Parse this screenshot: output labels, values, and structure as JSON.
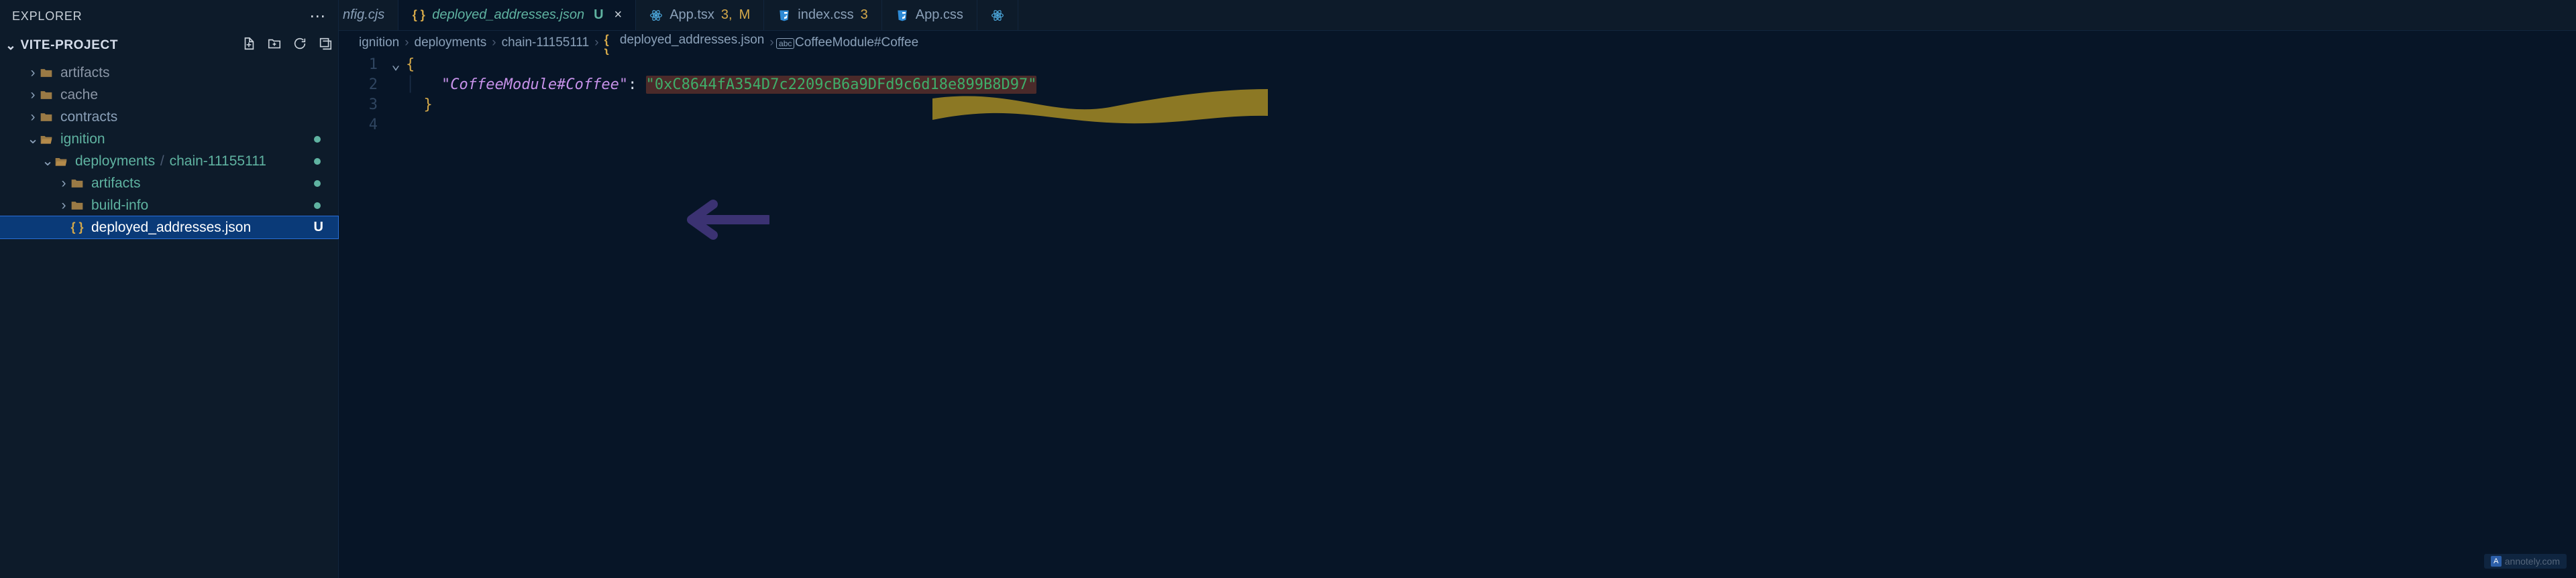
{
  "sidebar": {
    "title": "EXPLORER",
    "project": "VITE-PROJECT",
    "tree": [
      {
        "label": "artifacts",
        "kind": "folder-closed",
        "indent": 1,
        "color": "grey"
      },
      {
        "label": "cache",
        "kind": "folder-closed",
        "indent": 1,
        "color": "grey"
      },
      {
        "label": "contracts",
        "kind": "folder-closed",
        "indent": 1,
        "color": "white"
      },
      {
        "label": "ignition",
        "kind": "folder-open",
        "indent": 1,
        "color": "teal",
        "gitdot": true
      },
      {
        "label_a": "deployments",
        "label_b": "chain-11155111",
        "kind": "folder-path",
        "indent": 2,
        "color": "teal",
        "gitdot": true
      },
      {
        "label": "artifacts",
        "kind": "folder-closed",
        "indent": 3,
        "color": "teal",
        "gitdot": true
      },
      {
        "label": "build-info",
        "kind": "folder-closed",
        "indent": 3,
        "color": "teal",
        "gitdot": true
      },
      {
        "label": "deployed_addresses.json",
        "kind": "braces-file",
        "indent": 3,
        "color": "white",
        "selected": true,
        "gitletter": "U"
      }
    ]
  },
  "tabs": [
    {
      "label": "nfig.cjs",
      "style": "incomplete"
    },
    {
      "icon": "braces",
      "label": "deployed_addresses.json",
      "git": "U",
      "active": true,
      "close": true
    },
    {
      "icon": "react",
      "label": "App.tsx",
      "num": "3",
      "mod": "M",
      "plain": true
    },
    {
      "icon": "css3",
      "label": "index.css",
      "num": "3",
      "plain": true
    },
    {
      "icon": "css3",
      "label": "App.css",
      "plain": true
    },
    {
      "icon": "react-partial"
    }
  ],
  "breadcrumb": [
    {
      "label": "ignition"
    },
    {
      "label": "deployments"
    },
    {
      "label": "chain-11155111"
    },
    {
      "icon": "braces",
      "label": "deployed_addresses.json"
    },
    {
      "icon": "abc",
      "label": "CoffeeModule#Coffee"
    }
  ],
  "code": {
    "lines": [
      "1",
      "2",
      "3",
      "4"
    ],
    "key": "\"CoffeeModule#Coffee\"",
    "val": "\"0xC8644fA354D7c2209cB6a9DFd9c6d18e899B8D97\"",
    "address_raw": "0xC8644fA354D7c2209cB6a9DFd9c6d18e899B8D97"
  },
  "watermark": "annotely.com"
}
